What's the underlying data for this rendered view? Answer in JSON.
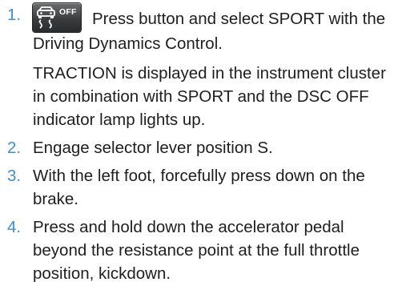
{
  "icons": {
    "dsc_button": "dsc-off-button-icon",
    "dsc_button_text": "OFF"
  },
  "colors": {
    "step_number": "#3a8fd6",
    "text": "#1e1e1e"
  },
  "steps": [
    {
      "number": "1.",
      "paragraphs": [
        "Press button and select SPORT with the Driving Dynamics Control.",
        "TRACTION is displayed in the instrument cluster in combination with SPORT and the DSC OFF indicator lamp lights up."
      ]
    },
    {
      "number": "2.",
      "paragraphs": [
        "Engage selector lever position S."
      ]
    },
    {
      "number": "3.",
      "paragraphs": [
        "With the left foot, forcefully press down on the brake."
      ]
    },
    {
      "number": "4.",
      "paragraphs": [
        "Press and hold down the accelerator pedal beyond the resistance point at the full throttle position, kickdown."
      ]
    }
  ]
}
